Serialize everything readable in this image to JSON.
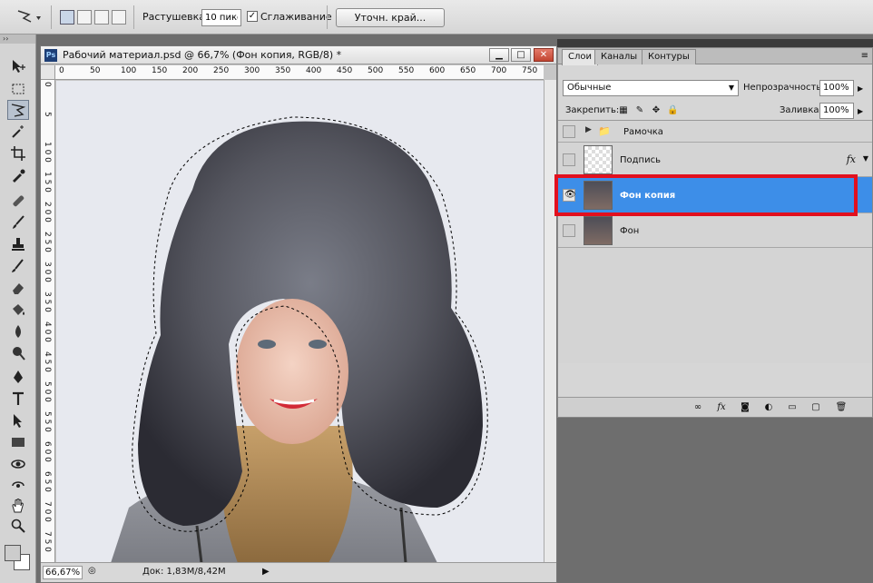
{
  "options_bar": {
    "tool_icon": "polygonal-lasso-icon",
    "feather_label": "Растушевка:",
    "feather_value": "10 пикс",
    "antialias_label": "Сглаживание",
    "antialias_checked": true,
    "refine_edge_label": "Уточн. край..."
  },
  "tools": {
    "selected": "polygonal-lasso",
    "foreground_color": "#cccccc",
    "background_color": "#ffffff"
  },
  "document": {
    "title": "Рабочий материал.psd @ 66,7% (Фон копия, RGB/8) *",
    "ruler_top": [
      "0",
      "50",
      "100",
      "150",
      "200",
      "250",
      "300",
      "350",
      "400",
      "450",
      "500",
      "550",
      "600",
      "650",
      "700",
      "750"
    ],
    "ruler_left": [
      "0",
      "5",
      "1 0 0",
      "1 5 0",
      "2 0 0",
      "2 5 0",
      "3 0 0",
      "3 5 0",
      "4 0 0",
      "4 5 0",
      "5 0 0",
      "5 5 0",
      "6 0 0",
      "6 5 0",
      "7 0 0",
      "7 5 0"
    ],
    "zoom": "66,67%",
    "doc_info": "Док: 1,83M/8,42M"
  },
  "layers_panel": {
    "tabs": [
      "Слои",
      "Каналы",
      "Контуры"
    ],
    "active_tab": "Слои",
    "blend_mode": "Обычные",
    "opacity_label": "Непрозрачность:",
    "opacity_value": "100%",
    "lock_label": "Закрепить:",
    "fill_label": "Заливка:",
    "fill_value": "100%",
    "layers": [
      {
        "name": "Рамочка",
        "type": "group",
        "visible": false
      },
      {
        "name": "Подпись",
        "type": "transparent",
        "visible": false,
        "fx": "fx"
      },
      {
        "name": "Фон копия",
        "type": "photo",
        "visible": true,
        "selected": true
      },
      {
        "name": "Фон",
        "type": "photo",
        "visible": false
      }
    ],
    "highlight_color": "#e2101e"
  }
}
